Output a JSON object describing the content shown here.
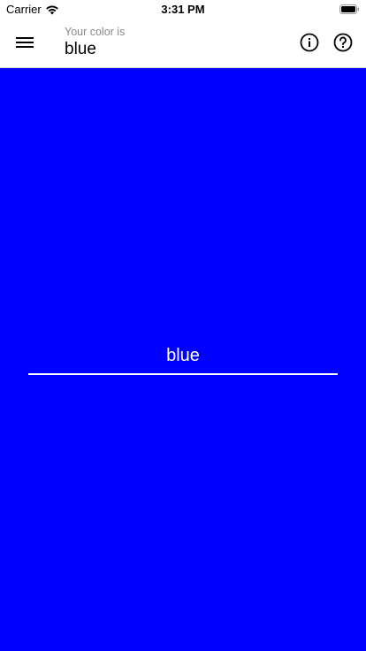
{
  "status_bar": {
    "carrier": "Carrier",
    "time": "3:31 PM"
  },
  "app_bar": {
    "subtitle": "Your color is",
    "title": "blue"
  },
  "color": {
    "name": "blue",
    "background": "#0000ff"
  },
  "color_input": {
    "value": "blue"
  },
  "icons": {
    "menu": "menu-icon",
    "info": "info-icon",
    "help": "help-icon",
    "wifi": "wifi-icon",
    "battery": "battery-icon"
  }
}
